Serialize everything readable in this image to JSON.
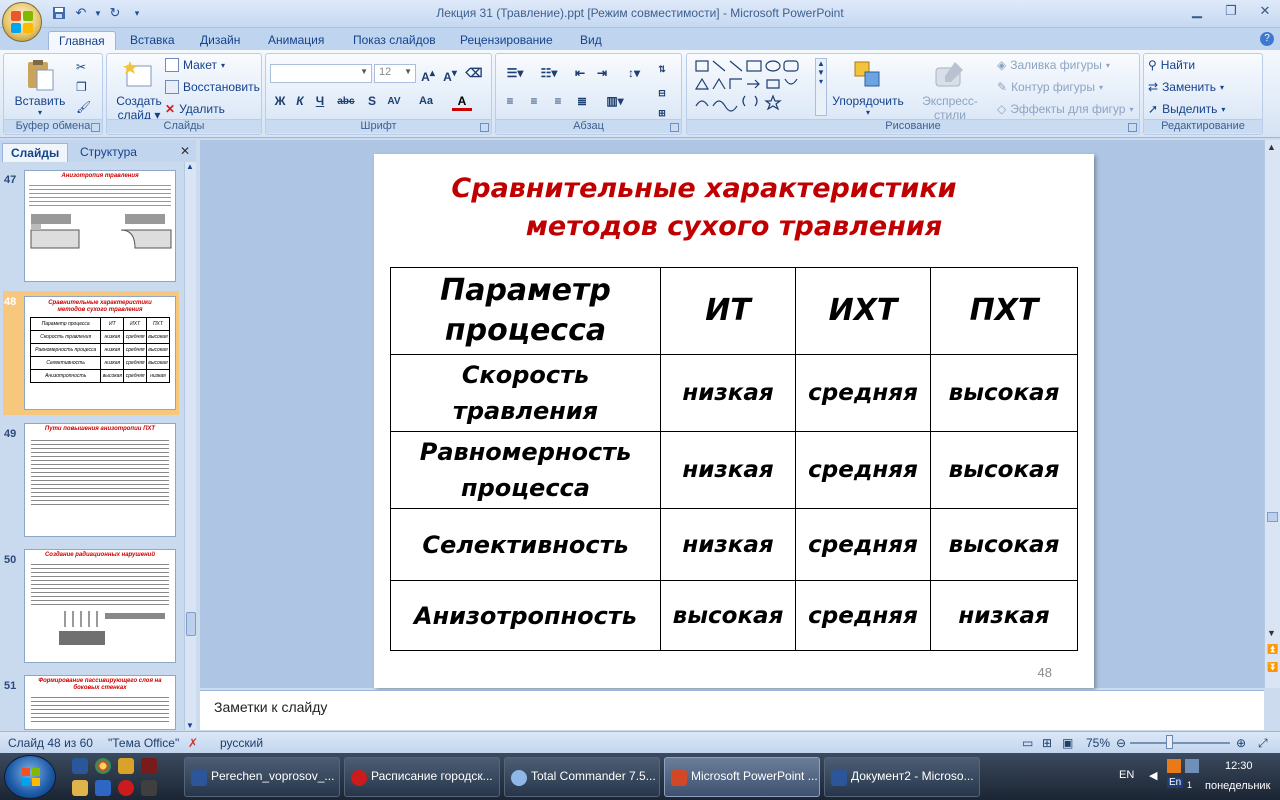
{
  "window": {
    "title": "Лекция 31 (Травление).ppt [Режим совместимости] - Microsoft PowerPoint"
  },
  "ribbon_tabs": [
    "Главная",
    "Вставка",
    "Дизайн",
    "Анимация",
    "Показ слайдов",
    "Рецензирование",
    "Вид"
  ],
  "ribbon": {
    "clipboard": {
      "label": "Буфер обмена",
      "paste": "Вставить"
    },
    "slides": {
      "label": "Слайды",
      "create_line1": "Создать",
      "create_line2": "слайд",
      "layout": "Макет",
      "reset": "Восстановить",
      "delete": "Удалить"
    },
    "font": {
      "label": "Шрифт",
      "size": "12"
    },
    "paragraph": {
      "label": "Абзац"
    },
    "drawing": {
      "label": "Рисование",
      "arrange": "Упорядочить",
      "quick_styles": "Экспресс-стили",
      "shape_fill": "Заливка фигуры",
      "shape_outline": "Контур фигуры",
      "shape_effects": "Эффекты для фигур"
    },
    "editing": {
      "label": "Редактирование",
      "find": "Найти",
      "replace": "Заменить",
      "select": "Выделить"
    }
  },
  "pane": {
    "tab_slides": "Слайды",
    "tab_outline": "Структура",
    "thumbnails": [
      {
        "num": "47",
        "title": "Анизотропия травления"
      },
      {
        "num": "48",
        "title": "Сравнительные характеристики методов сухого травления"
      },
      {
        "num": "49",
        "title": "Пути повышения анизотропии ПХТ"
      },
      {
        "num": "50",
        "title": "Создание радиационных нарушений"
      },
      {
        "num": "51",
        "title": "Формирование пассивирующего слоя на боковых стенках"
      }
    ]
  },
  "slide": {
    "title_line1": "Сравнительные характеристики",
    "title_line2": "методов сухого травления",
    "table": {
      "headers": [
        "Параметр процесса",
        "ИТ",
        "ИХТ",
        "ПХТ"
      ],
      "rows": [
        [
          "Скорость травления",
          "низкая",
          "средняя",
          "высокая"
        ],
        [
          "Равномерность процесса",
          "низкая",
          "средняя",
          "высокая"
        ],
        [
          "Селективность",
          "низкая",
          "средняя",
          "высокая"
        ],
        [
          "Анизотропность",
          "высокая",
          "средняя",
          "низкая"
        ]
      ]
    },
    "number": "48"
  },
  "notes": {
    "placeholder": "Заметки к слайду"
  },
  "status": {
    "slide_counter": "Слайд 48 из 60",
    "theme": "\"Тема Office\"",
    "language": "русский",
    "zoom": "75%"
  },
  "taskbar": {
    "tasks": [
      "Perechen_voprosov_...",
      "Расписание городск...",
      "Total Commander 7.5...",
      "Microsoft PowerPoint ...",
      "Документ2 - Microso..."
    ],
    "lang": "EN",
    "lang_badge": "En",
    "time": "12:30",
    "day": "понедельник"
  }
}
